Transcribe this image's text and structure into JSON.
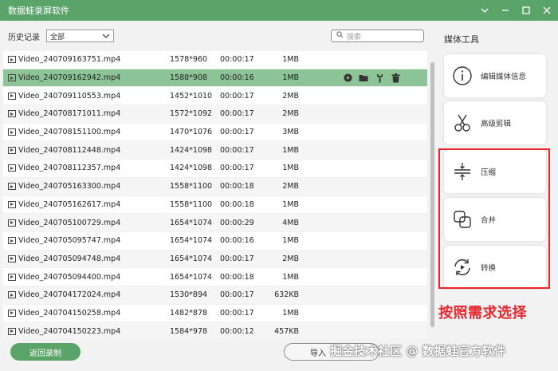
{
  "app": {
    "title": "数据蛙录屏软件"
  },
  "filter": {
    "label": "历史记录",
    "selected": "全部"
  },
  "search": {
    "placeholder": "搜索"
  },
  "files": [
    {
      "name": "Video_240709163751.mp4",
      "resolution": "1578*960",
      "duration": "00:00:17",
      "size": "1MB"
    },
    {
      "name": "Video_240709162942.mp4",
      "resolution": "1588*908",
      "duration": "00:00:16",
      "size": "1MB",
      "selected": true
    },
    {
      "name": "Video_240709110553.mp4",
      "resolution": "1452*1010",
      "duration": "00:00:17",
      "size": "2MB"
    },
    {
      "name": "Video_240708171011.mp4",
      "resolution": "1572*1092",
      "duration": "00:00:17",
      "size": "2MB"
    },
    {
      "name": "Video_240708151100.mp4",
      "resolution": "1470*1076",
      "duration": "00:00:17",
      "size": "3MB"
    },
    {
      "name": "Video_240708112448.mp4",
      "resolution": "1424*1098",
      "duration": "00:00:17",
      "size": "1MB"
    },
    {
      "name": "Video_240708112357.mp4",
      "resolution": "1424*1098",
      "duration": "00:00:17",
      "size": "1MB"
    },
    {
      "name": "Video_240705163300.mp4",
      "resolution": "1558*1100",
      "duration": "00:00:18",
      "size": "2MB"
    },
    {
      "name": "Video_240705162617.mp4",
      "resolution": "1558*1100",
      "duration": "00:00:18",
      "size": "1MB"
    },
    {
      "name": "Video_240705100729.mp4",
      "resolution": "1654*1074",
      "duration": "00:00:29",
      "size": "4MB"
    },
    {
      "name": "Video_240705095747.mp4",
      "resolution": "1654*1074",
      "duration": "00:00:16",
      "size": "1MB"
    },
    {
      "name": "Video_240705094748.mp4",
      "resolution": "1654*1074",
      "duration": "00:00:17",
      "size": "2MB"
    },
    {
      "name": "Video_240705094400.mp4",
      "resolution": "1654*1074",
      "duration": "00:00:18",
      "size": "1MB"
    },
    {
      "name": "Video_240704172024.mp4",
      "resolution": "1530*894",
      "duration": "00:00:17",
      "size": "632KB"
    },
    {
      "name": "Video_240704150258.mp4",
      "resolution": "1482*878",
      "duration": "00:00:17",
      "size": "1MB"
    },
    {
      "name": "Video_240704150223.mp4",
      "resolution": "1584*978",
      "duration": "00:00:12",
      "size": "457KB"
    }
  ],
  "media_tools": {
    "title": "媒体工具",
    "items": [
      {
        "label": "编辑媒体信息",
        "icon": "info-icon"
      },
      {
        "label": "高级剪辑",
        "icon": "scissors-icon"
      },
      {
        "label": "压缩",
        "icon": "compress-icon"
      },
      {
        "label": "合并",
        "icon": "merge-icon"
      },
      {
        "label": "转换",
        "icon": "convert-icon"
      }
    ]
  },
  "annotation": "按照需求选择",
  "buttons": {
    "back": "返回录制",
    "import": "导入"
  },
  "watermark": "掘金技术社区 @ 数据蛙官方软件",
  "colors": {
    "accent": "#5aa469",
    "selected_row": "#8cc497",
    "highlight": "#e8262c"
  }
}
